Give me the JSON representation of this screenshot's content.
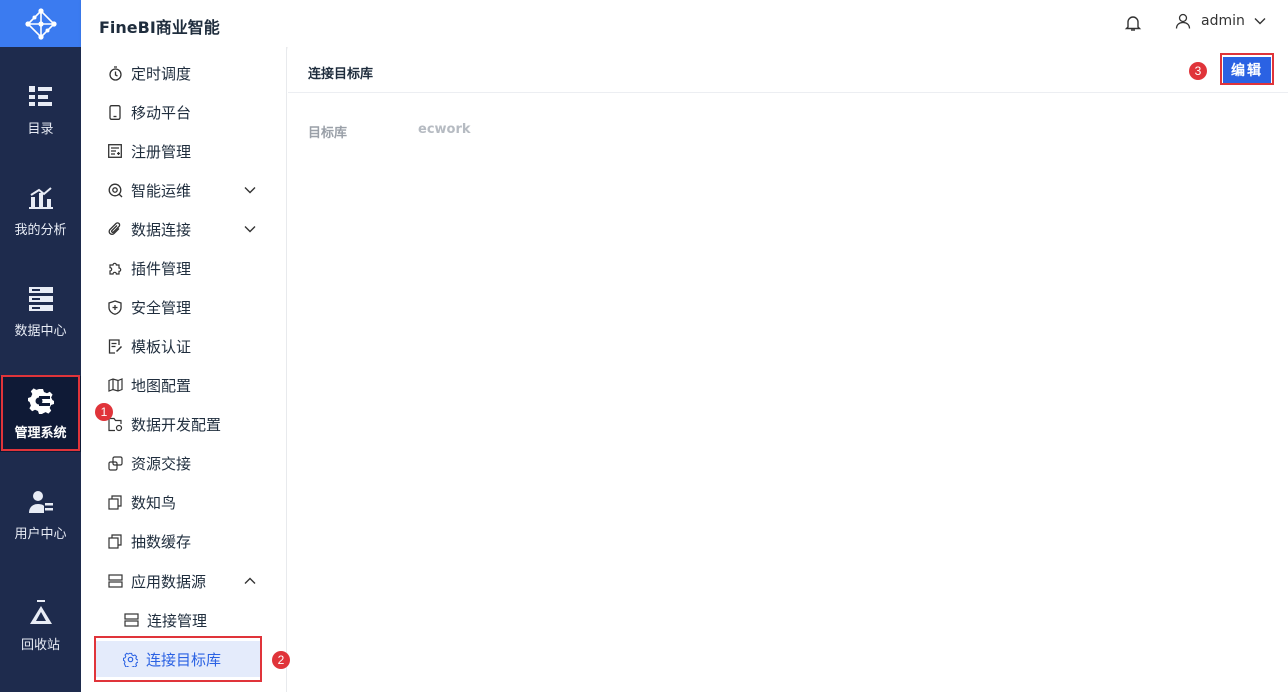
{
  "header": {
    "brand": "FineBI商业智能",
    "user": "admin"
  },
  "rail": [
    {
      "label": "目录",
      "icon": "catalog-icon"
    },
    {
      "label": "我的分析",
      "icon": "analysis-icon"
    },
    {
      "label": "数据中心",
      "icon": "data-center-icon"
    },
    {
      "label": "管理系统",
      "icon": "gear-icon",
      "active": true
    },
    {
      "label": "用户中心",
      "icon": "user-center-icon"
    },
    {
      "label": "回收站",
      "icon": "recycle-bin-icon"
    }
  ],
  "menu": {
    "items": [
      {
        "label": "定时调度",
        "icon": "timer-icon"
      },
      {
        "label": "移动平台",
        "icon": "mobile-icon"
      },
      {
        "label": "注册管理",
        "icon": "register-icon"
      },
      {
        "label": "智能运维",
        "icon": "ops-icon",
        "arrow": "down"
      },
      {
        "label": "数据连接",
        "icon": "paperclip-icon",
        "arrow": "down"
      },
      {
        "label": "插件管理",
        "icon": "puzzle-icon"
      },
      {
        "label": "安全管理",
        "icon": "shield-icon"
      },
      {
        "label": "模板认证",
        "icon": "template-icon"
      },
      {
        "label": "地图配置",
        "icon": "map-icon"
      },
      {
        "label": "数据开发配置",
        "icon": "dev-config-icon"
      },
      {
        "label": "资源交接",
        "icon": "handover-icon"
      },
      {
        "label": "数知鸟",
        "icon": "copy-icon"
      },
      {
        "label": "抽数缓存",
        "icon": "copy-icon"
      },
      {
        "label": "应用数据源",
        "icon": "datasource-icon",
        "arrow": "up"
      }
    ],
    "subitems": [
      {
        "label": "连接管理",
        "icon": "server-icon"
      },
      {
        "label": "连接目标库",
        "icon": "gear-icon",
        "selected": true
      }
    ]
  },
  "main": {
    "title": "连接目标库",
    "edit_label": "编辑",
    "field_label": "目标库",
    "field_value": "ecwork"
  },
  "annotations": [
    "1",
    "2",
    "3"
  ],
  "colors": {
    "rail": "#1e2b4d",
    "accent": "#2b62e3",
    "highlight": "#e0343a"
  }
}
